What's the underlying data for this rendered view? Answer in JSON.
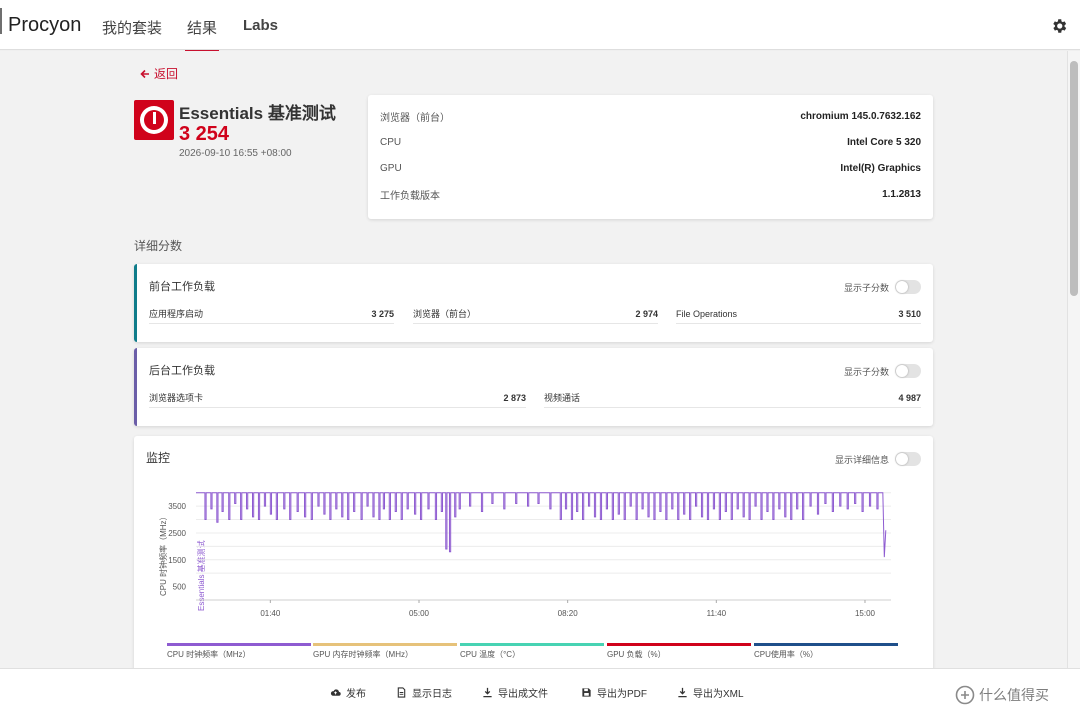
{
  "header": {
    "brand": "Procyon",
    "tabs": [
      {
        "label": "我的套装"
      },
      {
        "label": "结果"
      },
      {
        "label": "Labs"
      }
    ],
    "settings_icon": "gear-icon"
  },
  "back": {
    "label": "返回"
  },
  "result": {
    "title": "Essentials 基准测试",
    "score": "3 254",
    "datetime": "2026-09-10 16:55 +08:00"
  },
  "system_info": [
    {
      "label": "浏览器（前台）",
      "value": "chromium 145.0.7632.162"
    },
    {
      "label": "CPU",
      "value": "Intel Core 5 320"
    },
    {
      "label": "GPU",
      "value": "Intel(R) Graphics"
    },
    {
      "label": "工作负载版本",
      "value": "1.1.2813"
    }
  ],
  "detail_section_title": "详细分数",
  "workloads": [
    {
      "title": "前台工作负载",
      "toggle_label": "显示子分数",
      "accent": "#0f7c8a",
      "items": [
        {
          "label": "应用程序启动",
          "value": "3 275"
        },
        {
          "label": "浏览器（前台）",
          "value": "2 974"
        },
        {
          "label": "File Operations",
          "value": "3 510"
        }
      ]
    },
    {
      "title": "后台工作负载",
      "toggle_label": "显示子分数",
      "accent": "#6b5ea8",
      "items": [
        {
          "label": "浏览器选项卡",
          "value": "2 873"
        },
        {
          "label": "视频通话",
          "value": "4 987"
        }
      ]
    }
  ],
  "monitor": {
    "title": "监控",
    "toggle_label": "显示详细信息",
    "y_axis_label": "CPU 时钟频率（MHz）",
    "band_label": "Essentials 基准测试",
    "legend": [
      {
        "label": "CPU 时钟频率（MHz）",
        "color": "#8e5bd1"
      },
      {
        "label": "GPU 内存时钟频率（MHz）",
        "color": "#e6c27a"
      },
      {
        "label": "CPU 温度（°C）",
        "color": "#47d3b3"
      },
      {
        "label": "GPU 负载（%）",
        "color": "#d0021b"
      },
      {
        "label": "CPU使用率（%）",
        "color": "#1f4f8a"
      }
    ]
  },
  "chart_data": {
    "type": "line",
    "title": "",
    "xlabel": "",
    "ylabel": "CPU 时钟频率（MHz）",
    "x_ticks": [
      "01:40",
      "05:00",
      "08:20",
      "11:40",
      "15:00"
    ],
    "y_ticks": [
      500,
      1500,
      2500,
      3500
    ],
    "ylim": [
      0,
      4400
    ],
    "x_range_seconds": [
      0,
      935
    ],
    "series": [
      {
        "name": "CPU 时钟频率（MHz）",
        "color": "#8e5bd1",
        "baseline": 4000,
        "dips": [
          {
            "t": 12,
            "v": 3000
          },
          {
            "t": 20,
            "v": 3400
          },
          {
            "t": 28,
            "v": 2900
          },
          {
            "t": 35,
            "v": 3300
          },
          {
            "t": 44,
            "v": 3000
          },
          {
            "t": 52,
            "v": 3600
          },
          {
            "t": 60,
            "v": 3000
          },
          {
            "t": 68,
            "v": 3400
          },
          {
            "t": 76,
            "v": 3100
          },
          {
            "t": 84,
            "v": 3000
          },
          {
            "t": 92,
            "v": 3500
          },
          {
            "t": 100,
            "v": 3200
          },
          {
            "t": 108,
            "v": 3000
          },
          {
            "t": 118,
            "v": 3400
          },
          {
            "t": 126,
            "v": 3000
          },
          {
            "t": 136,
            "v": 3300
          },
          {
            "t": 146,
            "v": 3100
          },
          {
            "t": 155,
            "v": 3000
          },
          {
            "t": 164,
            "v": 3500
          },
          {
            "t": 172,
            "v": 3200
          },
          {
            "t": 180,
            "v": 3000
          },
          {
            "t": 188,
            "v": 3400
          },
          {
            "t": 196,
            "v": 3100
          },
          {
            "t": 204,
            "v": 3000
          },
          {
            "t": 212,
            "v": 3300
          },
          {
            "t": 222,
            "v": 3000
          },
          {
            "t": 230,
            "v": 3500
          },
          {
            "t": 238,
            "v": 3100
          },
          {
            "t": 246,
            "v": 3000
          },
          {
            "t": 252,
            "v": 3400
          },
          {
            "t": 260,
            "v": 3000
          },
          {
            "t": 268,
            "v": 3300
          },
          {
            "t": 276,
            "v": 3000
          },
          {
            "t": 284,
            "v": 3400
          },
          {
            "t": 294,
            "v": 3200
          },
          {
            "t": 302,
            "v": 3000
          },
          {
            "t": 312,
            "v": 3400
          },
          {
            "t": 322,
            "v": 3000
          },
          {
            "t": 330,
            "v": 3300
          },
          {
            "t": 336,
            "v": 1900
          },
          {
            "t": 341,
            "v": 1800
          },
          {
            "t": 348,
            "v": 3100
          },
          {
            "t": 354,
            "v": 3400
          },
          {
            "t": 368,
            "v": 3500
          },
          {
            "t": 384,
            "v": 3300
          },
          {
            "t": 398,
            "v": 3600
          },
          {
            "t": 414,
            "v": 3400
          },
          {
            "t": 430,
            "v": 3600
          },
          {
            "t": 446,
            "v": 3500
          },
          {
            "t": 460,
            "v": 3600
          },
          {
            "t": 476,
            "v": 3400
          },
          {
            "t": 490,
            "v": 3000
          },
          {
            "t": 497,
            "v": 3400
          },
          {
            "t": 505,
            "v": 3000
          },
          {
            "t": 512,
            "v": 3300
          },
          {
            "t": 520,
            "v": 3000
          },
          {
            "t": 528,
            "v": 3500
          },
          {
            "t": 536,
            "v": 3100
          },
          {
            "t": 544,
            "v": 3000
          },
          {
            "t": 552,
            "v": 3400
          },
          {
            "t": 560,
            "v": 3000
          },
          {
            "t": 568,
            "v": 3200
          },
          {
            "t": 576,
            "v": 3000
          },
          {
            "t": 584,
            "v": 3500
          },
          {
            "t": 592,
            "v": 3000
          },
          {
            "t": 600,
            "v": 3400
          },
          {
            "t": 608,
            "v": 3100
          },
          {
            "t": 616,
            "v": 3000
          },
          {
            "t": 624,
            "v": 3300
          },
          {
            "t": 632,
            "v": 3000
          },
          {
            "t": 640,
            "v": 3400
          },
          {
            "t": 648,
            "v": 3000
          },
          {
            "t": 656,
            "v": 3200
          },
          {
            "t": 664,
            "v": 3000
          },
          {
            "t": 672,
            "v": 3500
          },
          {
            "t": 680,
            "v": 3100
          },
          {
            "t": 688,
            "v": 3000
          },
          {
            "t": 696,
            "v": 3400
          },
          {
            "t": 704,
            "v": 3000
          },
          {
            "t": 712,
            "v": 3300
          },
          {
            "t": 720,
            "v": 3000
          },
          {
            "t": 728,
            "v": 3400
          },
          {
            "t": 736,
            "v": 3100
          },
          {
            "t": 744,
            "v": 3000
          },
          {
            "t": 752,
            "v": 3500
          },
          {
            "t": 760,
            "v": 3000
          },
          {
            "t": 768,
            "v": 3300
          },
          {
            "t": 776,
            "v": 3000
          },
          {
            "t": 784,
            "v": 3400
          },
          {
            "t": 792,
            "v": 3100
          },
          {
            "t": 800,
            "v": 3000
          },
          {
            "t": 808,
            "v": 3400
          },
          {
            "t": 816,
            "v": 3000
          },
          {
            "t": 826,
            "v": 3500
          },
          {
            "t": 836,
            "v": 3200
          },
          {
            "t": 846,
            "v": 3600
          },
          {
            "t": 856,
            "v": 3300
          },
          {
            "t": 866,
            "v": 3500
          },
          {
            "t": 876,
            "v": 3400
          },
          {
            "t": 886,
            "v": 3600
          },
          {
            "t": 896,
            "v": 3300
          },
          {
            "t": 906,
            "v": 3500
          },
          {
            "t": 916,
            "v": 3400
          }
        ],
        "tail": [
          {
            "t": 924,
            "v": 4000
          },
          {
            "t": 926,
            "v": 1600
          },
          {
            "t": 928,
            "v": 2600
          }
        ]
      }
    ],
    "grid": true,
    "legend_position": "bottom"
  },
  "footer": {
    "buttons": [
      {
        "label": "发布",
        "icon": "cloud-upload-icon"
      },
      {
        "label": "显示日志",
        "icon": "document-icon"
      },
      {
        "label": "导出成文件",
        "icon": "download-icon"
      },
      {
        "label": "导出为PDF",
        "icon": "save-icon"
      },
      {
        "label": "导出为XML",
        "icon": "download-icon"
      }
    ],
    "watermark": "什么值得买"
  }
}
